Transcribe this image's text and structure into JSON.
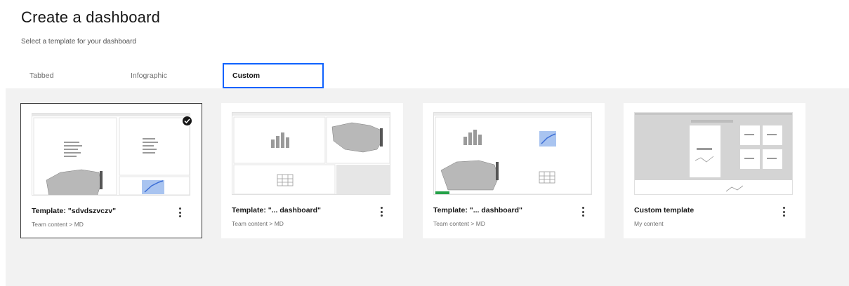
{
  "page": {
    "title": "Create a dashboard",
    "subtitle": "Select a template for your dashboard"
  },
  "tabs": [
    {
      "label": "Tabbed",
      "selected": false
    },
    {
      "label": "Infographic",
      "selected": false
    },
    {
      "label": "Custom",
      "selected": true
    }
  ],
  "templates": [
    {
      "title": "Template: \"sdvdszvczv\"",
      "subtitle": "Team content > MD",
      "selected": true
    },
    {
      "title": "Template: \"... dashboard\"",
      "subtitle": "Team content > MD",
      "selected": false
    },
    {
      "title": "Template: \"... dashboard\"",
      "subtitle": "Team content > MD",
      "selected": false
    },
    {
      "title": "Custom template",
      "subtitle": "My content",
      "selected": false
    }
  ],
  "colors": {
    "accent": "#0f62fe",
    "gallery_bg": "#f2f2f2",
    "selected_border": "#393939",
    "status_green": "#24a148"
  }
}
